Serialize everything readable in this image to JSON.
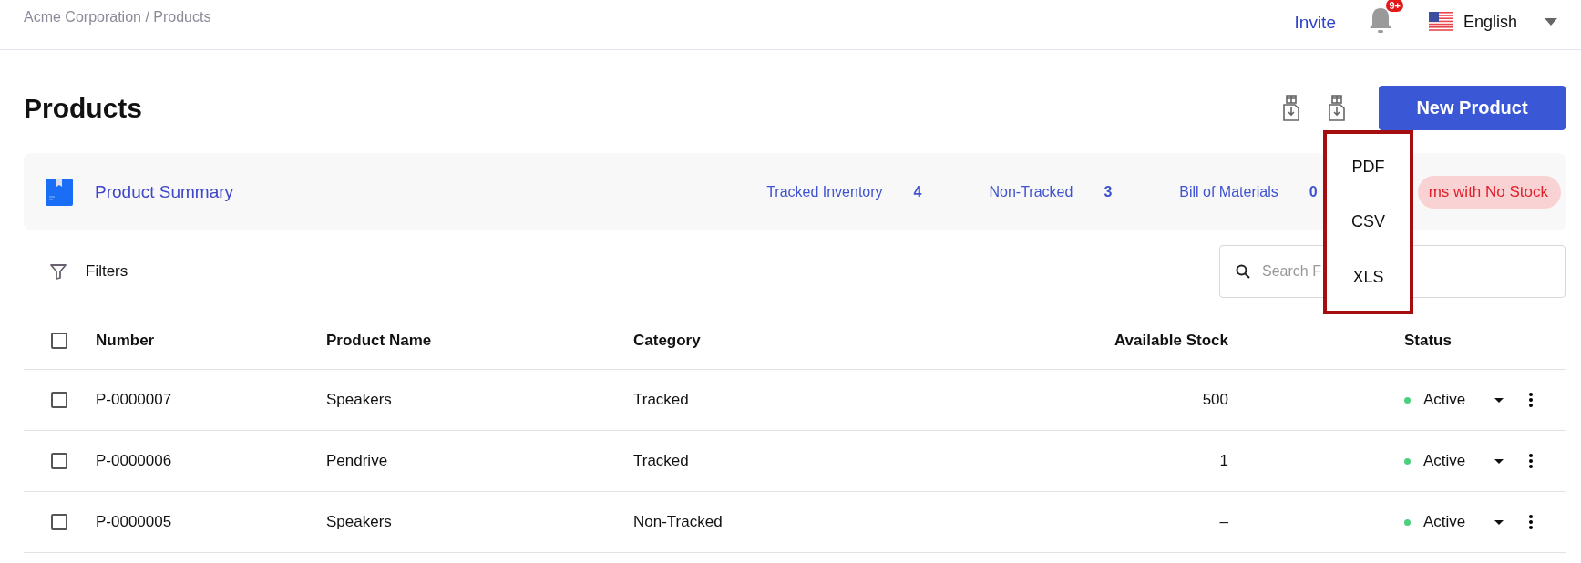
{
  "breadcrumb": "Acme Corporation / Products",
  "header": {
    "invite": "Invite",
    "notification_badge": "9+",
    "language": "English"
  },
  "page_title": "Products",
  "new_button": "New Product",
  "export_menu": {
    "items": [
      "PDF",
      "CSV",
      "XLS"
    ]
  },
  "summary": {
    "title": "Product Summary",
    "stats": [
      {
        "label": "Tracked Inventory",
        "value": "4"
      },
      {
        "label": "Non-Tracked",
        "value": "3"
      },
      {
        "label": "Bill of Materials",
        "value": "0"
      }
    ],
    "pill": "ms with No Stock"
  },
  "filters": "Filters",
  "search": {
    "placeholder": "Search F"
  },
  "table": {
    "columns": [
      "Number",
      "Product Name",
      "Category",
      "Available Stock",
      "Status"
    ],
    "all_checked": false,
    "rows": [
      {
        "checked": false,
        "number": "P-0000007",
        "name": "Speakers",
        "category": "Tracked",
        "stock": "500",
        "status": "Active",
        "color": "#4cd07d"
      },
      {
        "checked": false,
        "number": "P-0000006",
        "name": "Pendrive",
        "category": "Tracked",
        "stock": "1",
        "status": "Active",
        "color": "#4cd07d"
      },
      {
        "checked": false,
        "number": "P-0000005",
        "name": "Speakers",
        "category": "Non-Tracked",
        "stock": "–",
        "status": "Active",
        "color": "#4cd07d"
      }
    ]
  }
}
